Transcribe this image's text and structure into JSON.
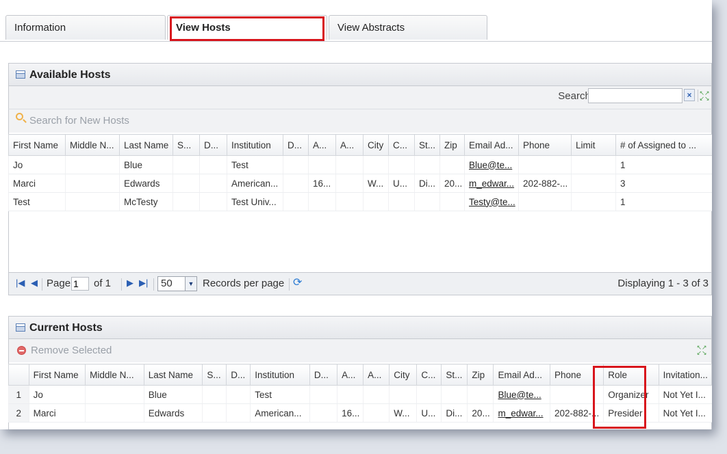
{
  "tabs": [
    {
      "label": "Information"
    },
    {
      "label": "View Hosts"
    },
    {
      "label": "View Abstracts"
    }
  ],
  "available": {
    "title": "Available Hosts",
    "search_label": "Search:",
    "search_value": "",
    "clear_label": "×",
    "action_label": "Search for New Hosts",
    "columns": [
      "First Name",
      "Middle N...",
      "Last Name",
      "S...",
      "D...",
      "Institution",
      "D...",
      "A...",
      "A...",
      "City",
      "C...",
      "St...",
      "Zip",
      "Email Ad...",
      "Phone",
      "Limit",
      "# of Assigned to ..."
    ],
    "rows": [
      [
        "Jo",
        "",
        "Blue",
        "",
        "",
        "Test",
        "",
        "",
        "",
        "",
        "",
        "",
        "",
        "Blue@te...",
        "",
        "",
        "1"
      ],
      [
        "Marci",
        "",
        "Edwards",
        "",
        "",
        "American...",
        "",
        "16...",
        "",
        "W...",
        "U...",
        "Di...",
        "20...",
        "m_edwar...",
        "202-882-...",
        "",
        "3"
      ],
      [
        "Test",
        "",
        "McTesty",
        "",
        "",
        "Test Univ...",
        "",
        "",
        "",
        "",
        "",
        "",
        "",
        "Testy@te...",
        "",
        "",
        "1"
      ]
    ]
  },
  "pager": {
    "page_label": "Page",
    "page_value": "1",
    "of_label": "of 1",
    "page_size": "50",
    "records_label": "Records per page",
    "displaying": "Displaying 1 - 3 of 3"
  },
  "current": {
    "title": "Current Hosts",
    "action_label": "Remove Selected",
    "columns": [
      "",
      "First Name",
      "Middle N...",
      "Last Name",
      "S...",
      "D...",
      "Institution",
      "D...",
      "A...",
      "A...",
      "City",
      "C...",
      "St...",
      "Zip",
      "Email Ad...",
      "Phone",
      "Role",
      "Invitation..."
    ],
    "rows": [
      [
        "1",
        "Jo",
        "",
        "Blue",
        "",
        "",
        "Test",
        "",
        "",
        "",
        "",
        "",
        "",
        "",
        "Blue@te...",
        "",
        "Organizer",
        "Not Yet I..."
      ],
      [
        "2",
        "Marci",
        "",
        "Edwards",
        "",
        "",
        "American...",
        "",
        "16...",
        "",
        "W...",
        "U...",
        "Di...",
        "20...",
        "m_edwar...",
        "202-882-...",
        "Presider",
        "Not Yet I..."
      ]
    ]
  },
  "colors": {
    "highlight": "#d8141c",
    "link": "#222222",
    "disabled_text": "#9aa0a8"
  },
  "icons": {
    "grid": "grid-table-icon",
    "search": "magnifier-icon",
    "remove": "minus-circle-icon",
    "expand": "expand-arrows-icon",
    "refresh": "refresh-icon"
  }
}
